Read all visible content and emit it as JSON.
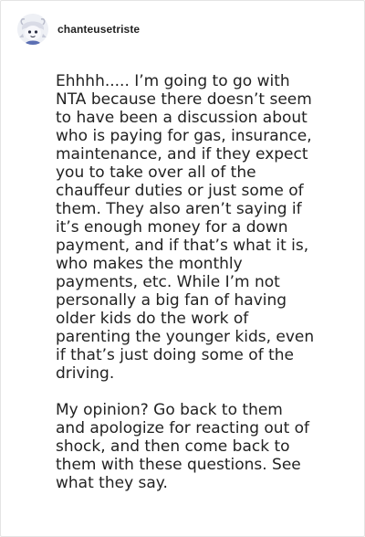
{
  "post": {
    "author": {
      "username": "chanteusetriste",
      "avatar_icon": "ghost-character-avatar"
    },
    "paragraphs": [
      "Ehhhh..... I’m going to go with\nNTA because there doesn’t seem\nto have been a discussion about\nwho is paying for gas, insurance,\nmaintenance, and if they expect\nyou to take over all of the\nchauffeur duties or just some of\nthem. They also aren’t saying if\nit’s enough money for a down\npayment, and if that’s what it is,\nwho makes the monthly\npayments, etc. While I’m not\npersonally a big fan of having\nolder kids do the work of\nparenting the younger kids, even\nif that’s just doing some of the\ndriving.",
      "My opinion? Go back to them\nand apologize for reacting out of\nshock, and then come back to\nthem with these questions. See\nwhat they say."
    ]
  },
  "colors": {
    "text": "#222222",
    "border": "#e4e4e4",
    "background": "#ffffff",
    "avatar_accent": "#5b6fb3"
  }
}
